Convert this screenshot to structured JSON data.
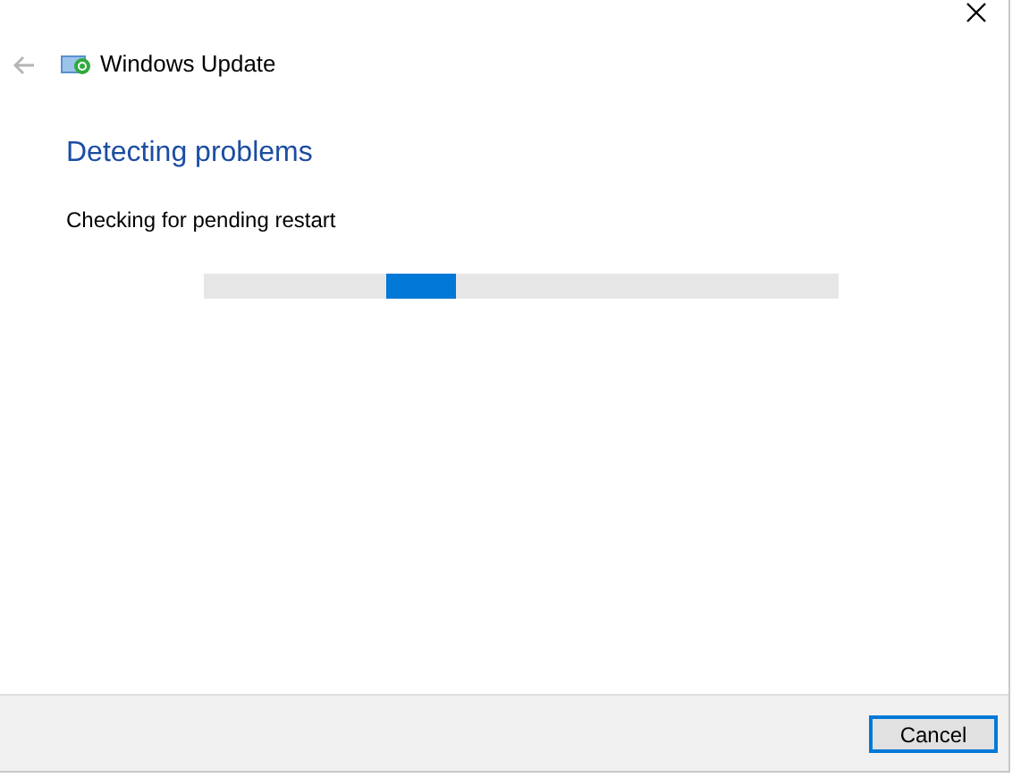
{
  "window": {
    "title": "Windows Update",
    "back_disabled": true
  },
  "heading": "Detecting problems",
  "status": "Checking for pending restart",
  "progress": {
    "kind": "marquee"
  },
  "buttons": [
    {
      "label": "Cancel",
      "focused": true
    }
  ]
}
